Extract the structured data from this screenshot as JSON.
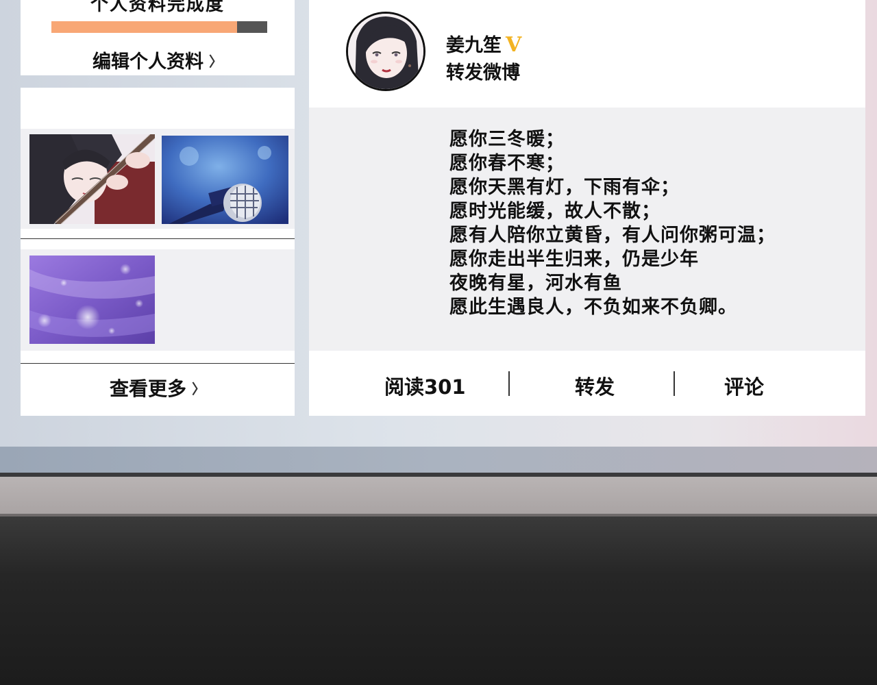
{
  "profile": {
    "completion_title": "个人资料完成度",
    "completion_fraction": 0.86,
    "edit_link": "编辑个人资料",
    "chevron": "〉"
  },
  "album": {
    "images": [
      {
        "name": "guitar-girl-image"
      },
      {
        "name": "microphone-image"
      },
      {
        "name": "purple-sparkle-image"
      }
    ],
    "more_link": "查看更多",
    "chevron": "〉"
  },
  "post": {
    "user_name": "姜九笙",
    "verified_badge": "V",
    "post_type": "转发微博",
    "lines": [
      "愿你三冬暖；",
      "愿你春不寒；",
      "愿你天黑有灯，下雨有伞；",
      "愿时光能缓，故人不散；",
      "愿有人陪你立黄昏，有人问你粥可温；",
      "愿你走出半生归来，仍是少年",
      "夜晚有星，河水有鱼",
      "愿此生遇良人，不负如来不负卿。"
    ],
    "actions": {
      "read": "阅读301",
      "repost": "转发",
      "comment": "评论"
    }
  },
  "colors": {
    "progress_fill": "#f8a775",
    "progress_track": "#555555",
    "verified_badge": "#f2b322"
  }
}
